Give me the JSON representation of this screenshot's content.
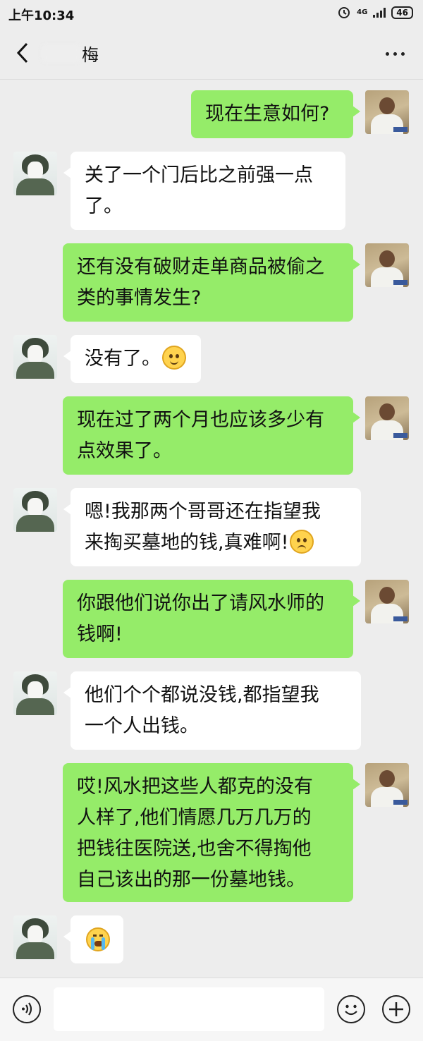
{
  "status": {
    "time": "上午10:34",
    "network": "4G",
    "battery": "46"
  },
  "header": {
    "title_suffix": "梅"
  },
  "messages": [
    {
      "side": "right",
      "lines": [
        "现在生意如何?"
      ]
    },
    {
      "side": "left",
      "lines": [
        "关了一个门后比之前强一点",
        "了。"
      ]
    },
    {
      "side": "right",
      "lines": [
        "还有没有破财走单商品被偷之",
        "类的事情发生?"
      ]
    },
    {
      "side": "left",
      "lines": [
        "没有了。"
      ],
      "emoji": "smile-emoji"
    },
    {
      "side": "right",
      "lines": [
        "现在过了两个月也应该多少有",
        "点效果了。"
      ]
    },
    {
      "side": "left",
      "lines": [
        "嗯!我那两个哥哥还在指望我",
        "来掏买墓地的钱,真难啊!"
      ],
      "emoji": "worried-emoji"
    },
    {
      "side": "right",
      "lines": [
        "你跟他们说你出了请风水师的",
        "钱啊!"
      ]
    },
    {
      "side": "left",
      "lines": [
        "他们个个都说没钱,都指望我",
        "一个人出钱。"
      ]
    },
    {
      "side": "right",
      "lines": [
        "哎!风水把这些人都克的没有",
        "人样了,他们情愿几万几万的",
        "把钱往医院送,也舍不得掏他",
        "自己该出的那一份墓地钱。"
      ]
    },
    {
      "side": "left",
      "lines": [],
      "emoji": "crying-emoji"
    }
  ],
  "colors": {
    "sent_bubble": "#95ec69",
    "received_bubble": "#ffffff",
    "background": "#ededed"
  }
}
